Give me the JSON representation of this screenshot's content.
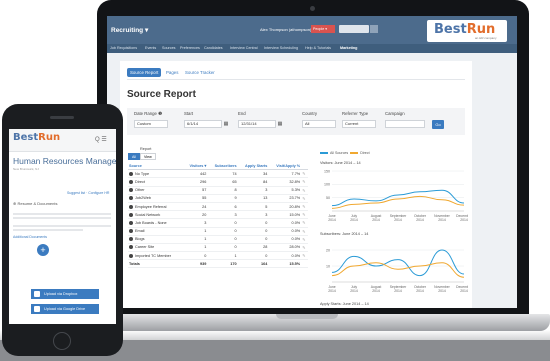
{
  "app": {
    "name": "Recruiting ▾",
    "user": "Alex Thompson (athompson) ▾",
    "people_select": "People ▾",
    "logo_main": "Best",
    "logo_accent": "Run",
    "logo_tag": "an HR company"
  },
  "nav": [
    "Job Requisitions",
    "Events",
    "Sources",
    "Preferences",
    "Candidates",
    "Interview Central",
    "Interview Scheduling",
    "Help & Tutorials",
    "Marketing"
  ],
  "tabs": [
    "Source Report",
    "Pages",
    "Source Tracker"
  ],
  "page_title": "Source Report",
  "filters": {
    "date_range_label": "Date Range ❶",
    "date_range_value": "Custom",
    "start_label": "Start",
    "start_value": "6/1/14",
    "end_label": "End",
    "end_value": "12/31/14",
    "country_label": "Country",
    "country_value": "All",
    "referrer_label": "Referrer Type",
    "referrer_value": "Current",
    "campaign_label": "Campaign",
    "campaign_value": "",
    "go": "Go"
  },
  "view": {
    "label": "Report",
    "options": [
      "All",
      "View"
    ]
  },
  "table": {
    "columns": [
      "Source",
      "Visitors ▾",
      "Subscribers",
      "Apply Starts",
      "Visit/Apply %"
    ],
    "rows": [
      [
        "No Type",
        "442",
        "74",
        "34",
        "7.7%"
      ],
      [
        "Direct",
        "296",
        "65",
        "84",
        "32.8%"
      ],
      [
        "Other",
        "57",
        "8",
        "3",
        "5.3%"
      ],
      [
        "Job2Web",
        "55",
        "9",
        "13",
        "23.7%"
      ],
      [
        "Employee Referral",
        "24",
        "6",
        "5",
        "20.8%"
      ],
      [
        "Social Network",
        "20",
        "3",
        "3",
        "15.0%"
      ],
      [
        "Job Boards - None",
        "3",
        "0",
        "0",
        "0.0%"
      ],
      [
        "Email",
        "1",
        "0",
        "0",
        "0.0%"
      ],
      [
        "Blogs",
        "1",
        "0",
        "0",
        "0.0%"
      ],
      [
        "Career Site",
        "1",
        "0",
        "28",
        "28.0%"
      ],
      [
        "Imported TC Member",
        "0",
        "1",
        "0",
        "0.0%"
      ]
    ],
    "total": [
      "Totals",
      "939",
      "170",
      "164",
      "15.5%"
    ]
  },
  "legend": [
    "All Sources",
    "Direct"
  ],
  "colors": {
    "all_sources": "#2b9bd6",
    "direct": "#f0a830",
    "primary": "#3b7bc0",
    "header": "#4c6b8c"
  },
  "chart_data": [
    {
      "type": "line",
      "title": "Visitors: June 2014 – 14",
      "x": [
        "June 2014",
        "July 2014",
        "August 2014",
        "September 2014",
        "October 2014",
        "November 2014",
        "December 2014"
      ],
      "series": [
        {
          "name": "All Sources",
          "values": [
            20,
            45,
            38,
            60,
            72,
            78,
            30
          ]
        },
        {
          "name": "Direct",
          "values": [
            10,
            25,
            30,
            45,
            55,
            42,
            22
          ]
        }
      ],
      "yticks": [
        50,
        100,
        150
      ],
      "ylim": [
        0,
        150
      ]
    },
    {
      "type": "line",
      "title": "Subscribers: June 2014 – 14",
      "x": [
        "June 2014",
        "July 2014",
        "August 2014",
        "September 2014",
        "October 2014",
        "November 2014",
        "December 2014"
      ],
      "series": [
        {
          "name": "All Sources",
          "values": [
            6,
            16,
            10,
            14,
            4,
            20,
            5
          ]
        },
        {
          "name": "Direct",
          "values": [
            4,
            10,
            12,
            8,
            10,
            12,
            3
          ]
        }
      ],
      "yticks": [
        10,
        20
      ],
      "ylim": [
        0,
        25
      ]
    }
  ],
  "chart3_title": "Apply Starts: June 2014 – 14",
  "phone": {
    "logo_main": "Best",
    "logo_accent": "Run",
    "icons": "Q ☰",
    "title": "Human Resources Manager",
    "subtitle": "New Brunswick, NJ",
    "link_top": "Suggest list · Configure HR",
    "section": "⊕ Resume & Documents",
    "additional": "Additional Documents",
    "btn1": "Upload via Dropbox",
    "btn2": "Upload via Google Drive"
  }
}
